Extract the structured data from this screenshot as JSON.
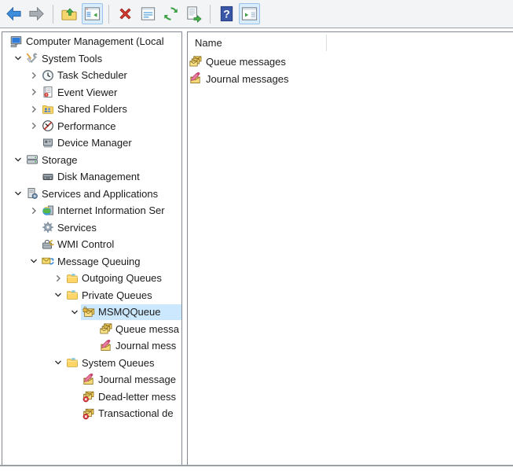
{
  "toolbar": {
    "items": [
      {
        "type": "button",
        "name": "back",
        "icon": "arrow-left-back"
      },
      {
        "type": "button",
        "name": "forward",
        "icon": "arrow-right-forward"
      },
      {
        "type": "separator"
      },
      {
        "type": "button",
        "name": "up-one-level",
        "icon": "folder-up"
      },
      {
        "type": "button",
        "name": "show-console-tree",
        "icon": "console-tree-window",
        "checked": true
      },
      {
        "type": "separator"
      },
      {
        "type": "button",
        "name": "delete",
        "icon": "delete-cross"
      },
      {
        "type": "button",
        "name": "properties",
        "icon": "properties-window"
      },
      {
        "type": "button",
        "name": "refresh",
        "icon": "refresh-arrows"
      },
      {
        "type": "button",
        "name": "export-list",
        "icon": "export-list-document"
      },
      {
        "type": "separator"
      },
      {
        "type": "button",
        "name": "help",
        "icon": "help-question"
      },
      {
        "type": "button",
        "name": "show-action-pane",
        "icon": "action-pane-window",
        "checked": true
      }
    ]
  },
  "tree": {
    "items": [
      {
        "label": "Computer Management (Local",
        "icon": "computer",
        "depth": 0,
        "chevron": null,
        "selected": false
      },
      {
        "label": "System Tools",
        "icon": "system-tools",
        "depth": 1,
        "chevron": "down",
        "selected": false
      },
      {
        "label": "Task Scheduler",
        "icon": "task-scheduler",
        "depth": 2,
        "chevron": "right",
        "selected": false
      },
      {
        "label": "Event Viewer",
        "icon": "event-viewer",
        "depth": 2,
        "chevron": "right",
        "selected": false
      },
      {
        "label": "Shared Folders",
        "icon": "shared-folders",
        "depth": 2,
        "chevron": "right",
        "selected": false
      },
      {
        "label": "Performance",
        "icon": "performance",
        "depth": 2,
        "chevron": "right",
        "selected": false
      },
      {
        "label": "Device Manager",
        "icon": "device-manager",
        "depth": 2,
        "chevron": null,
        "selected": false
      },
      {
        "label": "Storage",
        "icon": "storage",
        "depth": 1,
        "chevron": "down",
        "selected": false
      },
      {
        "label": "Disk Management",
        "icon": "disk-management",
        "depth": 2,
        "chevron": null,
        "selected": false
      },
      {
        "label": "Services and Applications",
        "icon": "services-applications",
        "depth": 1,
        "chevron": "down",
        "selected": false
      },
      {
        "label": "Internet Information Ser",
        "icon": "iis",
        "depth": 2,
        "chevron": "right",
        "selected": false
      },
      {
        "label": "Services",
        "icon": "services-gear",
        "depth": 2,
        "chevron": null,
        "selected": false
      },
      {
        "label": "WMI Control",
        "icon": "wmi-control",
        "depth": 2,
        "chevron": null,
        "selected": false
      },
      {
        "label": "Message Queuing",
        "icon": "message-queuing",
        "depth": 2,
        "chevron": "down",
        "selected": false
      },
      {
        "label": "Outgoing Queues",
        "icon": "folder",
        "depth": 3,
        "chevron": "right",
        "selected": false
      },
      {
        "label": "Private Queues",
        "icon": "folder",
        "depth": 3,
        "chevron": "down",
        "selected": false
      },
      {
        "label": "MSMQQueue",
        "icon": "queue-lock",
        "depth": 4,
        "chevron": "down",
        "selected": true
      },
      {
        "label": "Queue messa",
        "icon": "queue-messages",
        "depth": 5,
        "chevron": null,
        "selected": false
      },
      {
        "label": "Journal mess",
        "icon": "journal-messages",
        "depth": 5,
        "chevron": null,
        "selected": false
      },
      {
        "label": "System Queues",
        "icon": "folder",
        "depth": 3,
        "chevron": "down",
        "selected": false
      },
      {
        "label": "Journal message",
        "icon": "journal-messages",
        "depth": 4,
        "chevron": null,
        "selected": false
      },
      {
        "label": "Dead-letter mess",
        "icon": "dead-letter",
        "depth": 4,
        "chevron": null,
        "selected": false
      },
      {
        "label": "Transactional de",
        "icon": "dead-letter",
        "depth": 4,
        "chevron": null,
        "selected": false
      }
    ]
  },
  "list": {
    "columns": [
      {
        "label": "Name"
      }
    ],
    "rows": [
      {
        "label": "Queue messages",
        "icon": "queue-messages"
      },
      {
        "label": "Journal messages",
        "icon": "journal-messages"
      }
    ]
  },
  "colors": {
    "selection_highlight": "#cce8ff",
    "toolbar_toggle_bg": "#d9ecfb",
    "toolbar_toggle_border": "#9ac2e8",
    "panel_border": "#828790",
    "toolbar_border": "#9aa1a7"
  }
}
